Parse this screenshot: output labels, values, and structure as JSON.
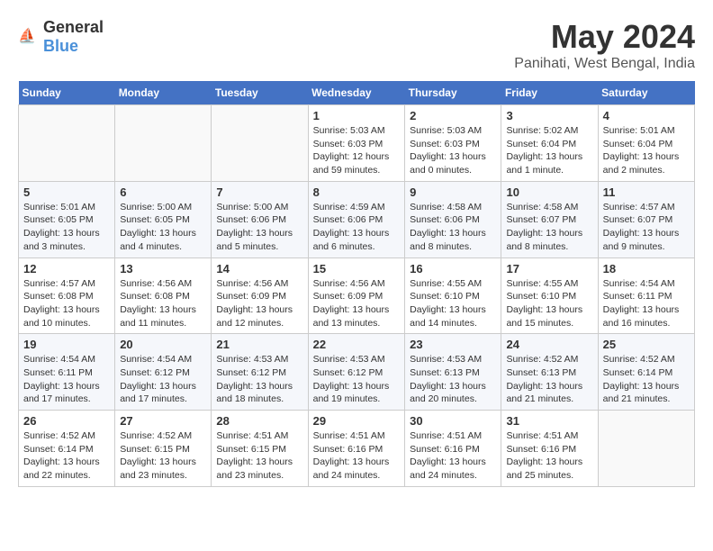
{
  "logo": {
    "general": "General",
    "blue": "Blue"
  },
  "title": "May 2024",
  "subtitle": "Panihati, West Bengal, India",
  "headers": [
    "Sunday",
    "Monday",
    "Tuesday",
    "Wednesday",
    "Thursday",
    "Friday",
    "Saturday"
  ],
  "weeks": [
    [
      {
        "day": "",
        "sunrise": "",
        "sunset": "",
        "daylight": ""
      },
      {
        "day": "",
        "sunrise": "",
        "sunset": "",
        "daylight": ""
      },
      {
        "day": "",
        "sunrise": "",
        "sunset": "",
        "daylight": ""
      },
      {
        "day": "1",
        "sunrise": "5:03 AM",
        "sunset": "6:03 PM",
        "daylight": "12 hours and 59 minutes."
      },
      {
        "day": "2",
        "sunrise": "5:03 AM",
        "sunset": "6:03 PM",
        "daylight": "13 hours and 0 minutes."
      },
      {
        "day": "3",
        "sunrise": "5:02 AM",
        "sunset": "6:04 PM",
        "daylight": "13 hours and 1 minute."
      },
      {
        "day": "4",
        "sunrise": "5:01 AM",
        "sunset": "6:04 PM",
        "daylight": "13 hours and 2 minutes."
      }
    ],
    [
      {
        "day": "5",
        "sunrise": "5:01 AM",
        "sunset": "6:05 PM",
        "daylight": "13 hours and 3 minutes."
      },
      {
        "day": "6",
        "sunrise": "5:00 AM",
        "sunset": "6:05 PM",
        "daylight": "13 hours and 4 minutes."
      },
      {
        "day": "7",
        "sunrise": "5:00 AM",
        "sunset": "6:06 PM",
        "daylight": "13 hours and 5 minutes."
      },
      {
        "day": "8",
        "sunrise": "4:59 AM",
        "sunset": "6:06 PM",
        "daylight": "13 hours and 6 minutes."
      },
      {
        "day": "9",
        "sunrise": "4:58 AM",
        "sunset": "6:06 PM",
        "daylight": "13 hours and 8 minutes."
      },
      {
        "day": "10",
        "sunrise": "4:58 AM",
        "sunset": "6:07 PM",
        "daylight": "13 hours and 8 minutes."
      },
      {
        "day": "11",
        "sunrise": "4:57 AM",
        "sunset": "6:07 PM",
        "daylight": "13 hours and 9 minutes."
      }
    ],
    [
      {
        "day": "12",
        "sunrise": "4:57 AM",
        "sunset": "6:08 PM",
        "daylight": "13 hours and 10 minutes."
      },
      {
        "day": "13",
        "sunrise": "4:56 AM",
        "sunset": "6:08 PM",
        "daylight": "13 hours and 11 minutes."
      },
      {
        "day": "14",
        "sunrise": "4:56 AM",
        "sunset": "6:09 PM",
        "daylight": "13 hours and 12 minutes."
      },
      {
        "day": "15",
        "sunrise": "4:56 AM",
        "sunset": "6:09 PM",
        "daylight": "13 hours and 13 minutes."
      },
      {
        "day": "16",
        "sunrise": "4:55 AM",
        "sunset": "6:10 PM",
        "daylight": "13 hours and 14 minutes."
      },
      {
        "day": "17",
        "sunrise": "4:55 AM",
        "sunset": "6:10 PM",
        "daylight": "13 hours and 15 minutes."
      },
      {
        "day": "18",
        "sunrise": "4:54 AM",
        "sunset": "6:11 PM",
        "daylight": "13 hours and 16 minutes."
      }
    ],
    [
      {
        "day": "19",
        "sunrise": "4:54 AM",
        "sunset": "6:11 PM",
        "daylight": "13 hours and 17 minutes."
      },
      {
        "day": "20",
        "sunrise": "4:54 AM",
        "sunset": "6:12 PM",
        "daylight": "13 hours and 17 minutes."
      },
      {
        "day": "21",
        "sunrise": "4:53 AM",
        "sunset": "6:12 PM",
        "daylight": "13 hours and 18 minutes."
      },
      {
        "day": "22",
        "sunrise": "4:53 AM",
        "sunset": "6:12 PM",
        "daylight": "13 hours and 19 minutes."
      },
      {
        "day": "23",
        "sunrise": "4:53 AM",
        "sunset": "6:13 PM",
        "daylight": "13 hours and 20 minutes."
      },
      {
        "day": "24",
        "sunrise": "4:52 AM",
        "sunset": "6:13 PM",
        "daylight": "13 hours and 21 minutes."
      },
      {
        "day": "25",
        "sunrise": "4:52 AM",
        "sunset": "6:14 PM",
        "daylight": "13 hours and 21 minutes."
      }
    ],
    [
      {
        "day": "26",
        "sunrise": "4:52 AM",
        "sunset": "6:14 PM",
        "daylight": "13 hours and 22 minutes."
      },
      {
        "day": "27",
        "sunrise": "4:52 AM",
        "sunset": "6:15 PM",
        "daylight": "13 hours and 23 minutes."
      },
      {
        "day": "28",
        "sunrise": "4:51 AM",
        "sunset": "6:15 PM",
        "daylight": "13 hours and 23 minutes."
      },
      {
        "day": "29",
        "sunrise": "4:51 AM",
        "sunset": "6:16 PM",
        "daylight": "13 hours and 24 minutes."
      },
      {
        "day": "30",
        "sunrise": "4:51 AM",
        "sunset": "6:16 PM",
        "daylight": "13 hours and 24 minutes."
      },
      {
        "day": "31",
        "sunrise": "4:51 AM",
        "sunset": "6:16 PM",
        "daylight": "13 hours and 25 minutes."
      },
      {
        "day": "",
        "sunrise": "",
        "sunset": "",
        "daylight": ""
      }
    ]
  ]
}
